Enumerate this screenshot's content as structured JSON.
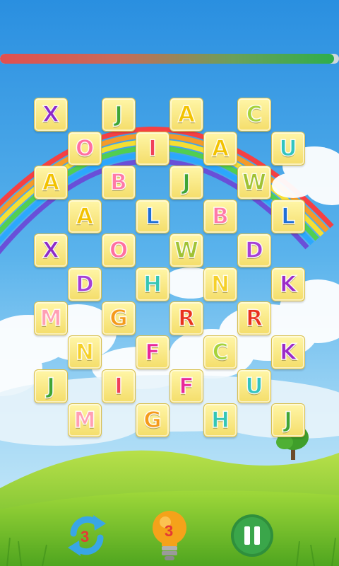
{
  "timer": {
    "remaining_fraction": 0.985
  },
  "tiles": [
    {
      "letter": "X",
      "color": "#8e2ac8",
      "col": 0,
      "row": 0
    },
    {
      "letter": "J",
      "color": "#3fa535",
      "col": 2,
      "row": 0
    },
    {
      "letter": "A",
      "color": "#f2c200",
      "col": 4,
      "row": 0
    },
    {
      "letter": "C",
      "color": "#a6d23a",
      "col": 6,
      "row": 0
    },
    {
      "letter": "O",
      "color": "#ff6fa0",
      "col": 1,
      "row": 1
    },
    {
      "letter": "I",
      "color": "#f0405a",
      "col": 3,
      "row": 1
    },
    {
      "letter": "A",
      "color": "#f2c200",
      "col": 5,
      "row": 1
    },
    {
      "letter": "U",
      "color": "#33c4c0",
      "col": 7,
      "row": 1
    },
    {
      "letter": "A",
      "color": "#f2c200",
      "col": 0,
      "row": 2
    },
    {
      "letter": "B",
      "color": "#ff7aa8",
      "col": 2,
      "row": 2
    },
    {
      "letter": "J",
      "color": "#3fa535",
      "col": 4,
      "row": 2
    },
    {
      "letter": "W",
      "color": "#a0c234",
      "col": 6,
      "row": 2
    },
    {
      "letter": "A",
      "color": "#f2c200",
      "col": 1,
      "row": 3
    },
    {
      "letter": "L",
      "color": "#1f6fd6",
      "col": 3,
      "row": 3
    },
    {
      "letter": "B",
      "color": "#ff7aa8",
      "col": 5,
      "row": 3
    },
    {
      "letter": "L",
      "color": "#1f6fd6",
      "col": 7,
      "row": 3
    },
    {
      "letter": "X",
      "color": "#8e2ac8",
      "col": 0,
      "row": 4
    },
    {
      "letter": "O",
      "color": "#ff6fa0",
      "col": 2,
      "row": 4
    },
    {
      "letter": "W",
      "color": "#a0c234",
      "col": 4,
      "row": 4
    },
    {
      "letter": "D",
      "color": "#a63fd6",
      "col": 6,
      "row": 4
    },
    {
      "letter": "D",
      "color": "#a63fd6",
      "col": 1,
      "row": 5
    },
    {
      "letter": "H",
      "color": "#35c6b4",
      "col": 3,
      "row": 5
    },
    {
      "letter": "N",
      "color": "#f5d02a",
      "col": 5,
      "row": 5
    },
    {
      "letter": "K",
      "color": "#9b2ac8",
      "col": 7,
      "row": 5
    },
    {
      "letter": "M",
      "color": "#ff9fb4",
      "col": 0,
      "row": 6
    },
    {
      "letter": "G",
      "color": "#f59a1a",
      "col": 2,
      "row": 6
    },
    {
      "letter": "R",
      "color": "#e8321e",
      "col": 4,
      "row": 6
    },
    {
      "letter": "R",
      "color": "#e8321e",
      "col": 6,
      "row": 6
    },
    {
      "letter": "N",
      "color": "#f5d02a",
      "col": 1,
      "row": 7
    },
    {
      "letter": "F",
      "color": "#e8289a",
      "col": 3,
      "row": 7
    },
    {
      "letter": "C",
      "color": "#a6d23a",
      "col": 5,
      "row": 7
    },
    {
      "letter": "K",
      "color": "#9b2ac8",
      "col": 7,
      "row": 7
    },
    {
      "letter": "J",
      "color": "#3fa535",
      "col": 0,
      "row": 8
    },
    {
      "letter": "I",
      "color": "#f0405a",
      "col": 2,
      "row": 8
    },
    {
      "letter": "F",
      "color": "#e8289a",
      "col": 4,
      "row": 8
    },
    {
      "letter": "U",
      "color": "#33c4c0",
      "col": 6,
      "row": 8
    },
    {
      "letter": "M",
      "color": "#ff9fb4",
      "col": 1,
      "row": 9
    },
    {
      "letter": "G",
      "color": "#f59a1a",
      "col": 3,
      "row": 9
    },
    {
      "letter": "H",
      "color": "#35c6b4",
      "col": 5,
      "row": 9
    },
    {
      "letter": "J",
      "color": "#3fa535",
      "col": 7,
      "row": 9
    }
  ],
  "controls": {
    "shuffle_count": "3",
    "hint_count": "3",
    "shuffle_icon": "shuffle-icon",
    "hint_icon": "lightbulb-icon",
    "pause_icon": "pause-icon"
  },
  "colors": {
    "sky_top": "#2a8fe0",
    "sky_bottom": "#bfe6f8",
    "grass": "#6fc12a",
    "tile_face": "#fbe98a",
    "pause_green": "#3aa64a",
    "bulb_orange": "#f5a21a",
    "shuffle_blue": "#39a6e6"
  }
}
